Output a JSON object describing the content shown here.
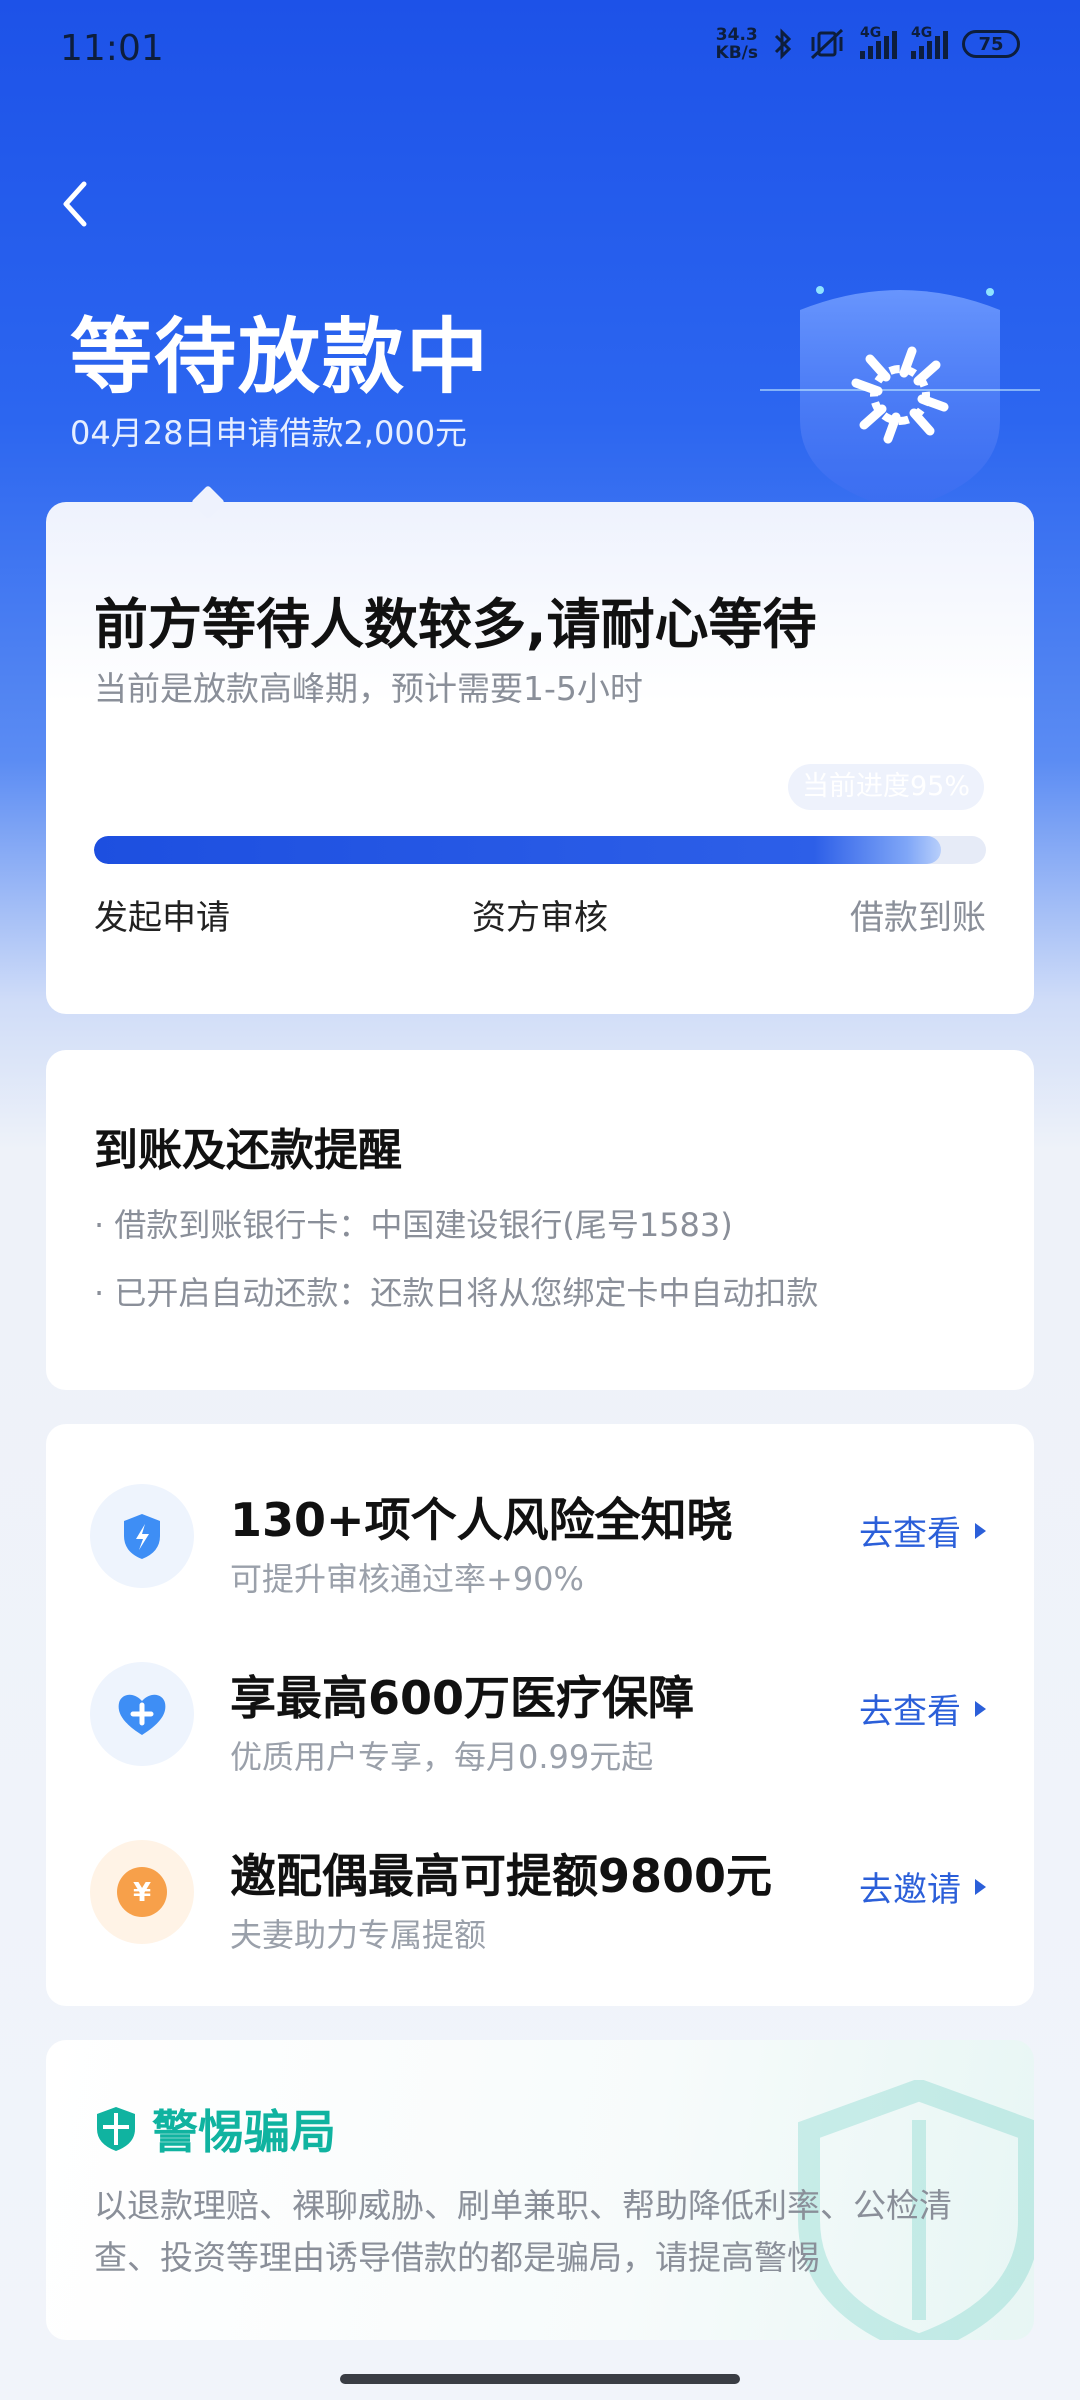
{
  "status_bar": {
    "time": "11:01",
    "net_speed_value": "34.3",
    "net_speed_unit": "KB/s",
    "signal_tag_1": "4G",
    "signal_tag_2": "4G",
    "battery": "75"
  },
  "header": {
    "title": "等待放款中",
    "subtitle": "04月28日申请借款2,000元"
  },
  "progress_card": {
    "title": "前方等待人数较多,请耐心等待",
    "subtitle": "当前是放款高峰期，预计需要1-5小时",
    "progress_tip": "当前进度95%",
    "progress_fraction": 0.95,
    "steps": [
      "发起申请",
      "资方审核",
      "借款到账"
    ]
  },
  "reminder": {
    "title": "到账及还款提醒",
    "lines": [
      "· 借款到账银行卡：中国建设银行(尾号1583)",
      "· 已开启自动还款：还款日将从您绑定卡中自动扣款"
    ]
  },
  "services": [
    {
      "icon": "lightning-shield-icon",
      "title": "130+项个人风险全知晓",
      "subtitle": "可提升审核通过率+90%",
      "action": "去查看"
    },
    {
      "icon": "heart-plus-icon",
      "title": "享最高600万医疗保障",
      "subtitle": "优质用户专享，每月0.99元起",
      "action": "去查看"
    },
    {
      "icon": "yuan-coin-icon",
      "title": "邀配偶最高可提额9800元",
      "subtitle": "夫妻助力专属提额",
      "action": "去邀请"
    }
  ],
  "fraud_warning": {
    "title": "警惕骗局",
    "text": "以退款理赔、裸聊威胁、刷单兼职、帮助降低利率、公检清查、投资等理由诱导借款的都是骗局，请提高警惕"
  },
  "colors": {
    "brand_blue": "#1d52e8",
    "action_blue": "#2b5fd9",
    "warning_teal": "#10b3a0",
    "coin_orange": "#f7a04a"
  }
}
